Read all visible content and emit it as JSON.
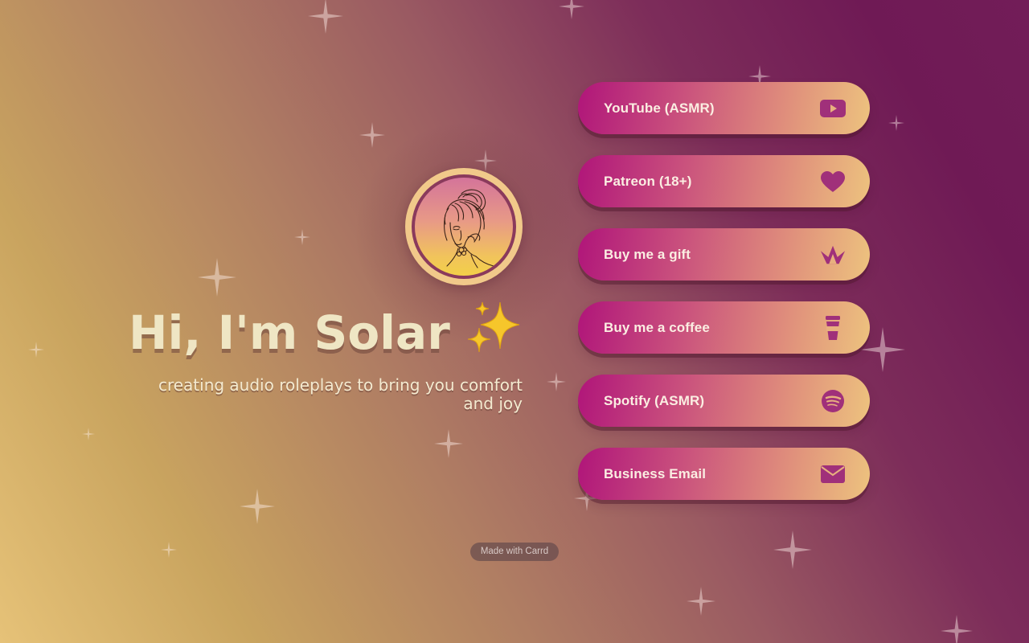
{
  "page": {
    "title": "Hi, I'm Solar",
    "title_emoji": "✨",
    "subtitle": "creating audio roleplays to bring you comfort and joy",
    "avatar_alt": "Solar avatar line drawing"
  },
  "links": [
    {
      "label": "YouTube (ASMR)",
      "icon": "youtube-icon"
    },
    {
      "label": "Patreon (18+)",
      "icon": "heart-icon"
    },
    {
      "label": "Buy me a gift",
      "icon": "crown-icon"
    },
    {
      "label": "Buy me a coffee",
      "icon": "coffee-cup-icon"
    },
    {
      "label": "Spotify (ASMR)",
      "icon": "spotify-icon"
    },
    {
      "label": "Business Email",
      "icon": "envelope-icon"
    }
  ],
  "footer": {
    "made_with": "Made with Carrd"
  },
  "colors": {
    "background_left": "#e6c278",
    "background_right": "#721d58",
    "button_left": "#b0157a",
    "button_right": "#edc37e",
    "icon": "#a0307a",
    "title_text": "#efe6c4"
  }
}
